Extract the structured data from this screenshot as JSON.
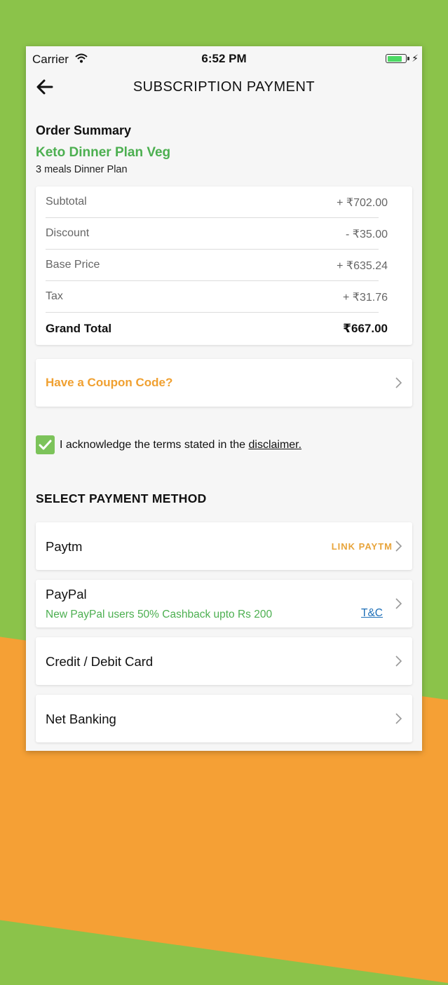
{
  "status_bar": {
    "carrier": "Carrier",
    "time": "6:52 PM",
    "battery_level": 0.85
  },
  "nav": {
    "title": "SUBSCRIPTION PAYMENT",
    "back_icon": "arrow-left-icon"
  },
  "order_summary": {
    "heading": "Order Summary",
    "plan_name": "Keto Dinner Plan Veg",
    "plan_description": "3 meals Dinner Plan",
    "rows": [
      {
        "label": "Subtotal",
        "value": "+ ₹702.00"
      },
      {
        "label": "Discount",
        "value": "- ₹35.00"
      },
      {
        "label": "Base Price",
        "value": "+ ₹635.24"
      },
      {
        "label": "Tax",
        "value": "+ ₹31.76"
      }
    ],
    "grand_total": {
      "label": "Grand Total",
      "value": "₹667.00"
    }
  },
  "coupon": {
    "label": "Have a Coupon Code?"
  },
  "acknowledge": {
    "checked": true,
    "text": "I acknowledge the terms stated in the ",
    "link": "disclaimer."
  },
  "payment": {
    "heading": "SELECT PAYMENT METHOD",
    "paytm": {
      "label": "Paytm",
      "action": "LINK PAYTM"
    },
    "paypal": {
      "label": "PayPal",
      "promo": "New PayPal users 50% Cashback upto Rs 200",
      "tnc": "T&C"
    },
    "card": {
      "label": "Credit / Debit Card"
    },
    "netbanking": {
      "label": "Net Banking"
    }
  },
  "colors": {
    "green": "#4caf50",
    "orange": "#f0a030",
    "link_blue": "#1e6fb8",
    "bg_green": "#8bc34a",
    "bg_orange": "#f5a035"
  }
}
